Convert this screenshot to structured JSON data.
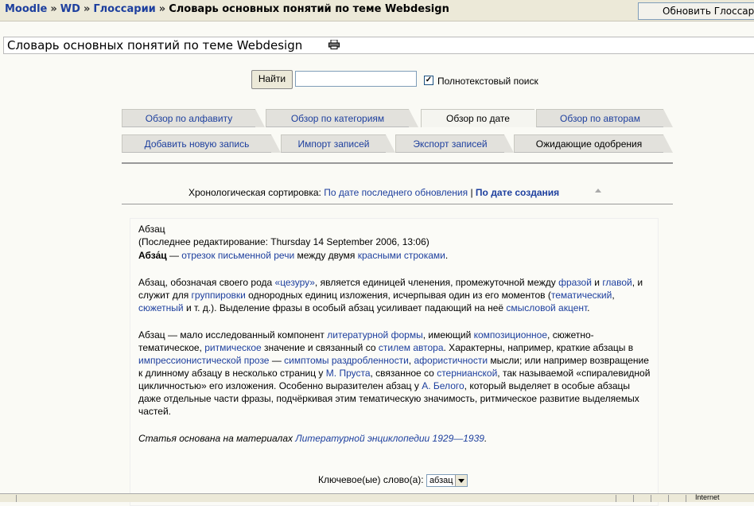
{
  "breadcrumb": {
    "items": [
      "Moodle",
      "WD",
      "Глоссарии"
    ],
    "separator": "»",
    "current": "Словарь основных понятий по теме Webdesign"
  },
  "update_button": "Обновить Глоссарий",
  "page_title": "Словарь основных понятий по теме Webdesign",
  "search": {
    "button": "Найти",
    "value": "",
    "fulltext_checked": true,
    "fulltext_label": "Полнотекстовый поиск"
  },
  "tabs_row1": [
    "Обзор по алфавиту",
    "Обзор по категориям",
    "Обзор по дате",
    "Обзор по авторам"
  ],
  "tabs_row2": [
    "Добавить новую запись",
    "Импорт записей",
    "Экспорт записей",
    "Ожидающие одобрения"
  ],
  "sort": {
    "label": "Хронологическая сортировка:",
    "option_updated": "По дате последнего обновления",
    "divider": "|",
    "option_created": "По дате создания"
  },
  "entry": {
    "concept": "Абзац",
    "last_modified": "(Последнее редактирование: Thursday 14 September 2006, 13:06)",
    "p1": {
      "lead": "Абза́ц",
      "dash": " — ",
      "l1": "отрезок письменной речи",
      "t1": " между двумя ",
      "l2": "красными строками",
      "t2": "."
    },
    "p2": {
      "t1": "Абзац, обозначая своего рода ",
      "l1": "«цезуру»",
      "t2": ", является единицей членения, промежуточной между ",
      "l2": "фразой",
      "t3": " и ",
      "l3": "главой",
      "t4": ", и служит для ",
      "l4": "группировки",
      "t5": " однородных единиц изложения, исчерпывая один из его моментов (",
      "l5": "тематический",
      "t6": ", ",
      "l6": "сюжетный",
      "t7": " и т. д.). Выделение фразы в особый абзац усиливает падающий на неё ",
      "l7": "смысловой акцент",
      "t8": "."
    },
    "p3": {
      "t1": "Абзац — мало исследованный компонент ",
      "l1": "литературной формы",
      "t2": ", имеющий ",
      "l2": "композиционное",
      "t3": ", сюжетно-тематическое, ",
      "l3": "ритмическое",
      "t4": " значение и связанный со ",
      "l4": "стилем автора",
      "t5": ". Характерны, например, краткие абзацы в ",
      "l5": "импрессионистической прозе",
      "t6": " — ",
      "l6": "симптомы раздробленности",
      "t7": ", ",
      "l7": "афористичности",
      "t8": " мысли; или например возвращение к длинному абзацу в несколько страниц у ",
      "l8": "М. Пруста",
      "t9": ", связанное со ",
      "l9": "стернианской",
      "t10": ", так называемой «спиралевидной цикличностью» его изложения. Особенно выразителен абзац у ",
      "l10": "А. Белого",
      "t11": ", который выделяет в особые абзацы даже отдельные части фразы, подчёркивая этим тематическую значимость, ритмическое развитие выделяемых частей."
    },
    "source": {
      "t1": "Статья основана на материалах ",
      "l1": "Литературной энциклопедии 1929—1939",
      "t2": "."
    },
    "keywords_label": "Ключевое(ые) слово(а):",
    "keyword_selected": "абзац"
  },
  "status": {
    "zone": "Internet"
  }
}
